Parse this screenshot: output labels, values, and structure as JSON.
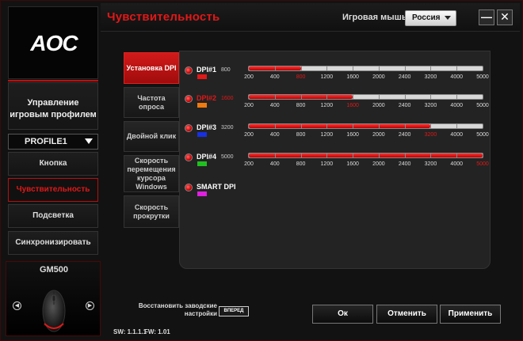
{
  "header": {
    "title": "Чувствительность",
    "device_label": "Игровая мышь",
    "language": "Россия",
    "minimize_icon": "minus-icon",
    "close_icon": "close-icon"
  },
  "sidebar": {
    "logo": "AOC",
    "profile_management": "Управление игровым профилем",
    "profile_selected": "PROFILE1",
    "items": [
      {
        "label": "Кнопка",
        "active": false
      },
      {
        "label": "Чувствительность",
        "active": true
      },
      {
        "label": "Подсветка",
        "active": false
      },
      {
        "label": "Синхронизировать",
        "active": false
      }
    ],
    "device": {
      "name": "GM500",
      "prev_icon": "chevron-left-icon",
      "next_icon": "chevron-right-icon"
    }
  },
  "tabs": [
    {
      "label": "Установка DPI",
      "active": true
    },
    {
      "label": "Частота опроса",
      "active": false
    },
    {
      "label": "Двойной клик",
      "active": false
    },
    {
      "label": "Скорость перемещения курсора Windows",
      "active": false
    },
    {
      "label": "Скорость прокрутки",
      "active": false
    }
  ],
  "dpi": {
    "ticks": [
      "200",
      "400",
      "800",
      "1200",
      "1600",
      "2000",
      "2400",
      "3200",
      "4000",
      "5000"
    ],
    "rows": [
      {
        "label": "DPI#1",
        "value": "800",
        "selected": false,
        "color": "#e01818",
        "fill_index": 2
      },
      {
        "label": "DPI#2",
        "value": "1600",
        "selected": true,
        "color": "#f07a10",
        "fill_index": 4
      },
      {
        "label": "DPI#3",
        "value": "3200",
        "selected": false,
        "color": "#1830e0",
        "fill_index": 7
      },
      {
        "label": "DPI#4",
        "value": "5000",
        "selected": false,
        "color": "#20c020",
        "fill_index": 9
      }
    ],
    "smart": {
      "label": "SMART DPI",
      "color": "#e020e0"
    }
  },
  "footer": {
    "reset_label": "Восстановить заводские настройки",
    "reset_button": "ВПЕРЕД",
    "ok": "Ок",
    "cancel": "Отменить",
    "apply": "Применить",
    "sw": "SW: 1.1.1.1",
    "fw": "FW: 1.01"
  }
}
